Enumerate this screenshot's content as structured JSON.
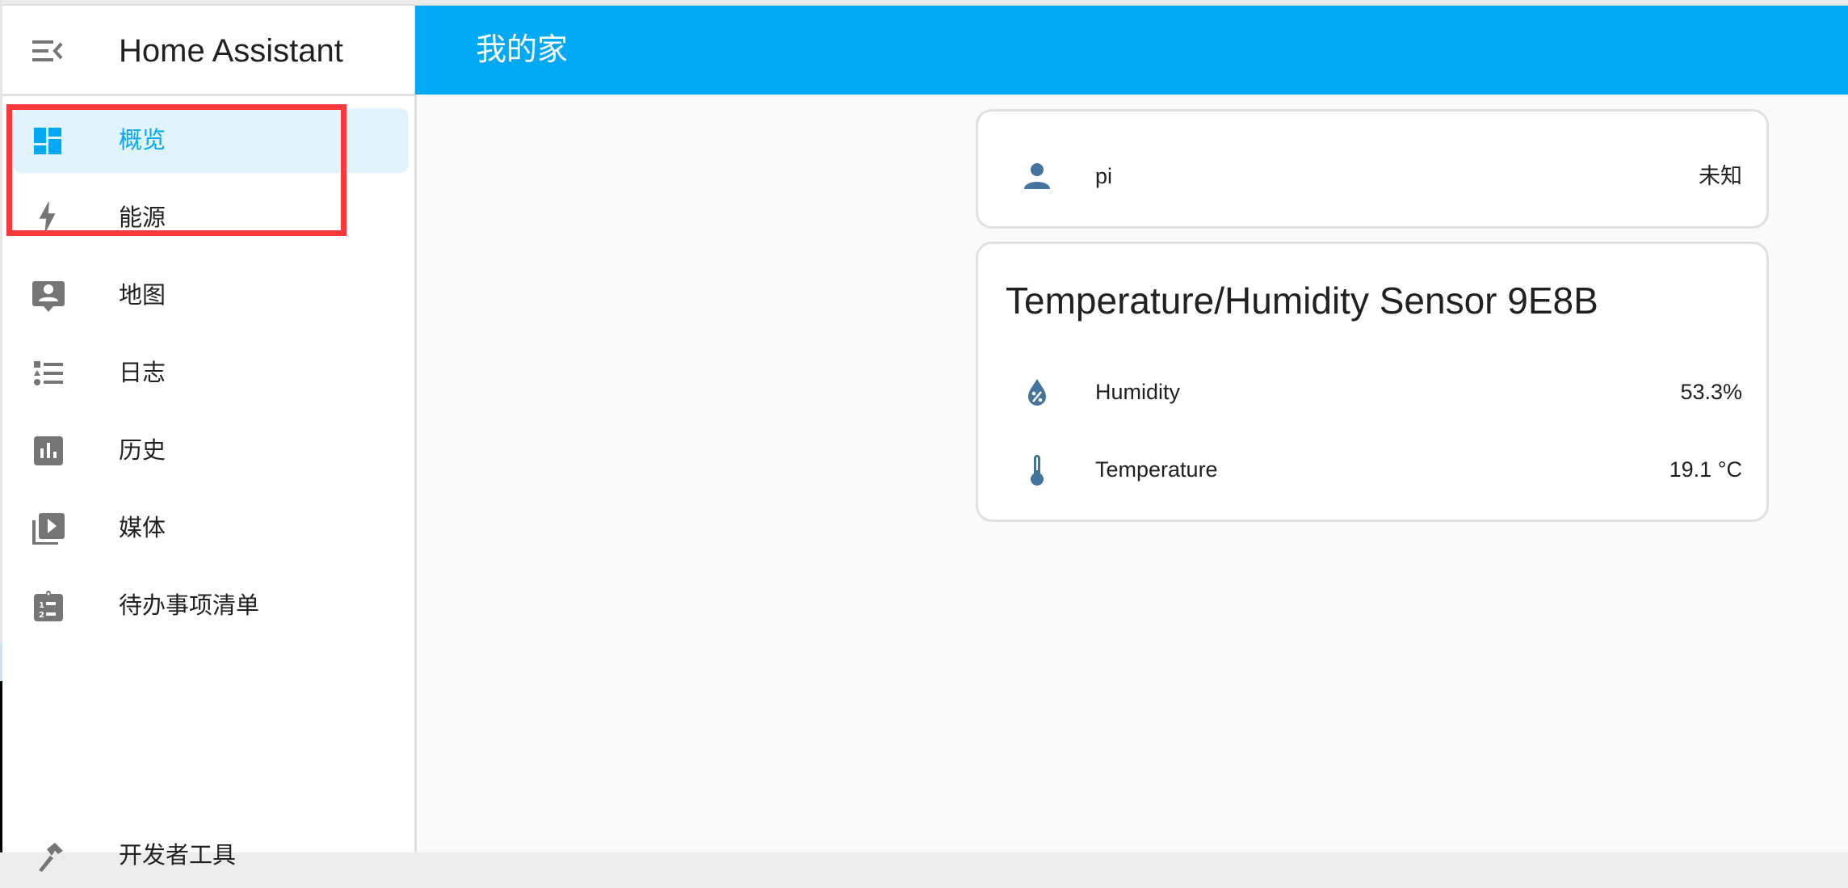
{
  "sidebar": {
    "app_title": "Home Assistant",
    "menu_icon": "menu-open-icon",
    "items": [
      {
        "label": "概览",
        "icon": "dashboard-icon",
        "selected": true
      },
      {
        "label": "能源",
        "icon": "lightning-bolt-icon",
        "selected": false
      },
      {
        "label": "地图",
        "icon": "map-account-icon",
        "selected": false
      },
      {
        "label": "日志",
        "icon": "format-list-icon",
        "selected": false
      },
      {
        "label": "历史",
        "icon": "chart-box-icon",
        "selected": false
      },
      {
        "label": "媒体",
        "icon": "play-box-multiple-icon",
        "selected": false
      },
      {
        "label": "待办事项清单",
        "icon": "clipboard-list-icon",
        "selected": false
      },
      {
        "label": "开发者工具",
        "icon": "hammer-icon",
        "selected": false
      }
    ]
  },
  "header": {
    "title": "我的家"
  },
  "colors": {
    "accent": "#03A9F4",
    "selected_bg": "#E1F4FC",
    "entity_icon": "#44739E",
    "annotation_box": "#FA3A3A"
  },
  "cards": {
    "person": {
      "name": "pi",
      "state": "未知",
      "icon": "account-icon"
    },
    "sensor": {
      "title": "Temperature/Humidity Sensor 9E8B",
      "rows": [
        {
          "name": "Humidity",
          "value": "53.3%",
          "icon": "water-percent-icon"
        },
        {
          "name": "Temperature",
          "value": "19.1 °C",
          "icon": "thermometer-icon"
        }
      ]
    }
  }
}
